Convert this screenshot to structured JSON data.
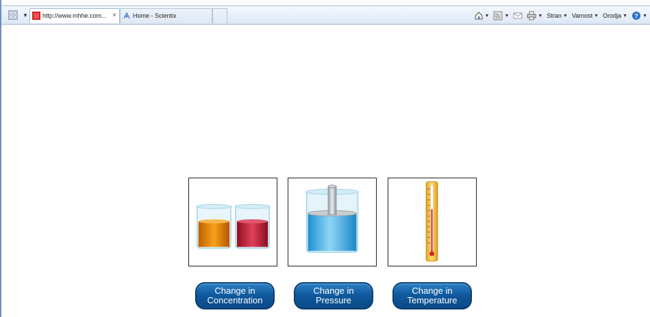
{
  "browser": {
    "tabs": [
      {
        "label": "http://www.mhhe.com...",
        "active": true
      },
      {
        "label": "Home - Scientix",
        "active": false
      }
    ],
    "close_glyph": "×",
    "commands": {
      "page": "Stran",
      "safety": "Varnost",
      "tools": "Orodja"
    }
  },
  "content": {
    "panels": [
      {
        "name": "concentration",
        "liquids": [
          "#e08a10",
          "#c0243a"
        ]
      },
      {
        "name": "pressure",
        "liquid": "#3fb2ea"
      },
      {
        "name": "temperature",
        "thermometer": "#f3c24a"
      }
    ],
    "buttons": [
      {
        "line1": "Change in",
        "line2": "Concentration"
      },
      {
        "line1": "Change in",
        "line2": "Pressure"
      },
      {
        "line1": "Change in",
        "line2": "Temperature"
      }
    ]
  },
  "colors": {
    "button": "#0f5a9e",
    "toolbar": "#dde8f5"
  }
}
